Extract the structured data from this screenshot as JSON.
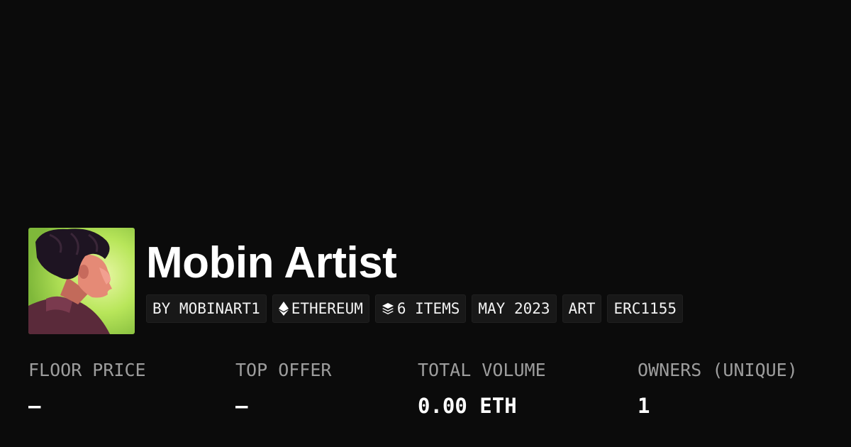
{
  "collection": {
    "name": "Mobin Artist",
    "avatar_alt": "avatar"
  },
  "tags": {
    "creator": "BY MOBINART1",
    "chain": "ETHEREUM",
    "items": "6 ITEMS",
    "date": "MAY 2023",
    "category": "ART",
    "standard": "ERC1155"
  },
  "stats": {
    "floor_price": {
      "label": "FLOOR PRICE",
      "value": "–"
    },
    "top_offer": {
      "label": "TOP OFFER",
      "value": "–"
    },
    "total_volume": {
      "label": "TOTAL VOLUME",
      "value": "0.00 ETH"
    },
    "owners": {
      "label": "OWNERS (UNIQUE)",
      "value": "1"
    }
  },
  "icons": {
    "chain": "ethereum-icon",
    "items": "layers-icon"
  },
  "colors": {
    "background": "#0b0b0b",
    "avatar_accent": "#b8e65a",
    "tag_background": "#181818",
    "label_gray": "#9d9d9d"
  }
}
